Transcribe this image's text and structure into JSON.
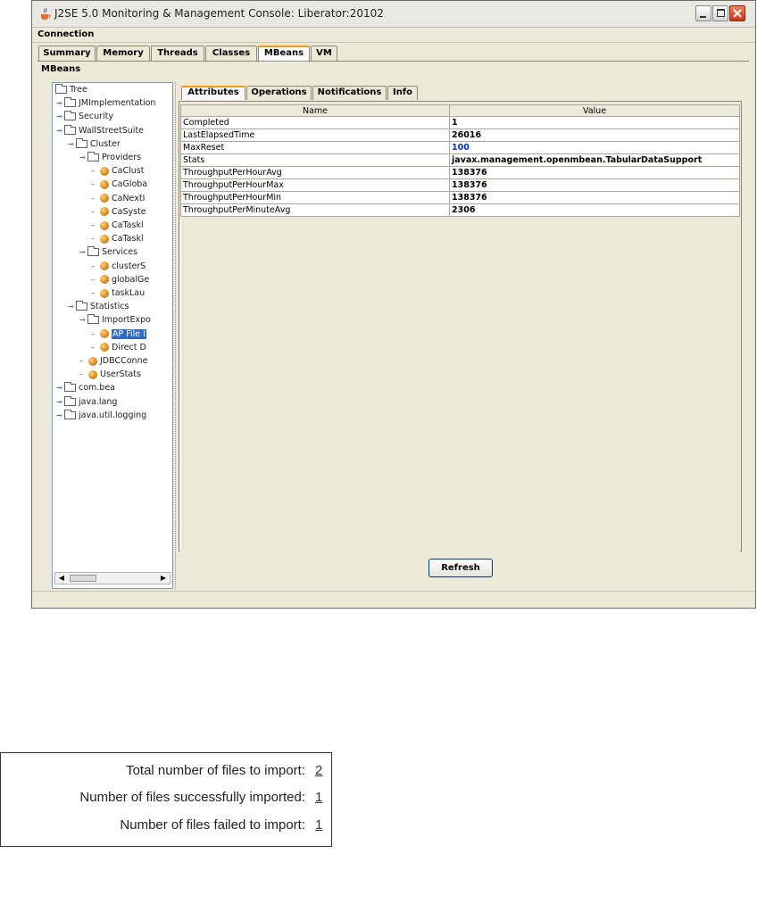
{
  "window": {
    "title": "J2SE 5.0 Monitoring & Management Console: Liberator:20102"
  },
  "menu": {
    "items": [
      "Connection"
    ]
  },
  "top_tabs": [
    "Summary",
    "Memory",
    "Threads",
    "Classes",
    "MBeans",
    "VM"
  ],
  "selected_top_tab": "MBeans",
  "section_label": "MBeans",
  "tree": [
    {
      "label": "Tree",
      "level": 0,
      "kind": "root"
    },
    {
      "label": "JMImplementation",
      "level": 0,
      "kind": "folder"
    },
    {
      "label": "Security",
      "level": 0,
      "kind": "folder"
    },
    {
      "label": "WallStreetSuite",
      "level": 0,
      "kind": "folder"
    },
    {
      "label": "Cluster",
      "level": 1,
      "kind": "folder"
    },
    {
      "label": "Providers",
      "level": 2,
      "kind": "folder"
    },
    {
      "label": "CaClust",
      "level": 3,
      "kind": "bean"
    },
    {
      "label": "CaGloba",
      "level": 3,
      "kind": "bean"
    },
    {
      "label": "CaNextI",
      "level": 3,
      "kind": "bean"
    },
    {
      "label": "CaSyste",
      "level": 3,
      "kind": "bean"
    },
    {
      "label": "CaTaskl",
      "level": 3,
      "kind": "bean"
    },
    {
      "label": "CaTaskl",
      "level": 3,
      "kind": "bean"
    },
    {
      "label": "Services",
      "level": 2,
      "kind": "folder"
    },
    {
      "label": "clusterS",
      "level": 3,
      "kind": "bean"
    },
    {
      "label": "globalGe",
      "level": 3,
      "kind": "bean"
    },
    {
      "label": "taskLau",
      "level": 3,
      "kind": "bean"
    },
    {
      "label": "Statistics",
      "level": 1,
      "kind": "folder"
    },
    {
      "label": "ImportExpo",
      "level": 2,
      "kind": "folder"
    },
    {
      "label": "AP File I",
      "level": 3,
      "kind": "bean",
      "selected": true
    },
    {
      "label": "Direct D",
      "level": 3,
      "kind": "bean"
    },
    {
      "label": "JDBCConne",
      "level": 2,
      "kind": "bean"
    },
    {
      "label": "UserStats",
      "level": 2,
      "kind": "bean"
    },
    {
      "label": "com.bea",
      "level": 0,
      "kind": "folder"
    },
    {
      "label": "java.lang",
      "level": 0,
      "kind": "folder"
    },
    {
      "label": "java.util.logging",
      "level": 0,
      "kind": "folder"
    }
  ],
  "inner_tabs": [
    "Attributes",
    "Operations",
    "Notifications",
    "Info"
  ],
  "selected_inner_tab": "Attributes",
  "attributes_table": {
    "headers": [
      "Name",
      "Value"
    ],
    "rows": [
      {
        "name": "Completed",
        "value": "1"
      },
      {
        "name": "LastElapsedTime",
        "value": "26016"
      },
      {
        "name": "MaxReset",
        "value": "100",
        "editable": true
      },
      {
        "name": "Stats",
        "value": "javax.management.openmbean.TabularDataSupport"
      },
      {
        "name": "ThroughputPerHourAvg",
        "value": "138376"
      },
      {
        "name": "ThroughputPerHourMax",
        "value": "138376"
      },
      {
        "name": "ThroughputPerHourMin",
        "value": "138376"
      },
      {
        "name": "ThroughputPerMinuteAvg",
        "value": "2306"
      }
    ]
  },
  "refresh_label": "Refresh",
  "import_summary": {
    "total_label": "Total number of files to import:",
    "total_value": "2",
    "success_label": "Number of files successfully imported:",
    "success_value": "1",
    "failed_label": "Number of files failed to import:",
    "failed_value": "1"
  },
  "colors": {
    "selection": "#316ac5",
    "tab_accent": "#ff9a00",
    "editable_value": "#0033cc"
  }
}
